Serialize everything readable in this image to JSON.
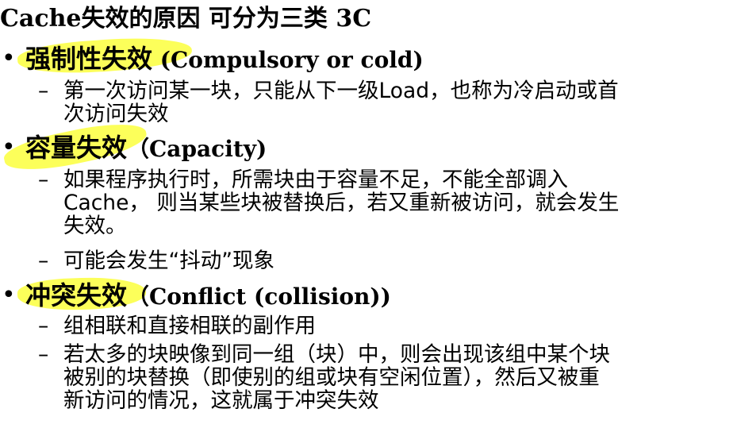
{
  "title": "Cache失效的原因 可分为三类  3C",
  "bullet_symbol": "•",
  "dash_symbol": "–",
  "sections": [
    {
      "heading_cn": "强制性失效",
      "heading_en": " (Compulsory or cold)",
      "items": [
        "第一次访问某一块，只能从下一级Load，也称为冷启动或首\n次访问失效"
      ]
    },
    {
      "heading_cn": "容量失效",
      "heading_en": "（Capacity)",
      "items": [
        "如果程序执行时，所需块由于容量不足，不能全部调入\nCache， 则当某些块被替换后，若又重新被访问，就会发生\n失效。",
        "可能会发生“抖动”现象"
      ]
    },
    {
      "heading_cn": "冲突失效",
      "heading_en": "（Conflict (collision))",
      "items": [
        "组相联和直接相联的副作用",
        "若太多的块映像到同一组（块）中，则会出现该组中某个块\n被别的块替换（即使别的组或块有空闲位置），然后又被重\n新访问的情况，这就属于冲突失效"
      ]
    }
  ],
  "highlight_color": "#fbff3d"
}
